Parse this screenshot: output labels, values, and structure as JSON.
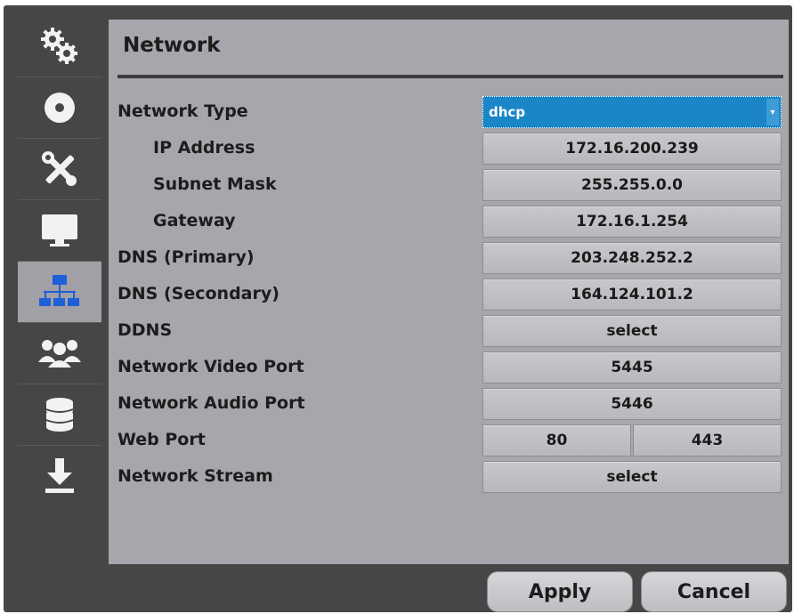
{
  "sidebar": {
    "items": [
      {
        "icon": "gears-icon",
        "active": false
      },
      {
        "icon": "disc-icon",
        "active": false
      },
      {
        "icon": "tools-icon",
        "active": false
      },
      {
        "icon": "monitor-icon",
        "active": false
      },
      {
        "icon": "network-icon",
        "active": true
      },
      {
        "icon": "users-icon",
        "active": false
      },
      {
        "icon": "database-icon",
        "active": false
      },
      {
        "icon": "download-icon",
        "active": false
      }
    ]
  },
  "page": {
    "title": "Network"
  },
  "settings": {
    "network_type": {
      "label": "Network Type",
      "value": "dhcp"
    },
    "ip_address": {
      "label": "IP Address",
      "value": "172.16.200.239"
    },
    "subnet_mask": {
      "label": "Subnet Mask",
      "value": "255.255.0.0"
    },
    "gateway": {
      "label": "Gateway",
      "value": "172.16.1.254"
    },
    "dns_primary": {
      "label": "DNS (Primary)",
      "value": "203.248.252.2"
    },
    "dns_secondary": {
      "label": "DNS (Secondary)",
      "value": "164.124.101.2"
    },
    "ddns": {
      "label": "DDNS",
      "value": "select"
    },
    "video_port": {
      "label": "Network Video Port",
      "value": "5445"
    },
    "audio_port": {
      "label": "Network Audio Port",
      "value": "5446"
    },
    "web_port": {
      "label": "Web Port",
      "http": "80",
      "https": "443"
    },
    "stream": {
      "label": "Network Stream",
      "value": "select"
    }
  },
  "actions": {
    "apply": "Apply",
    "cancel": "Cancel"
  },
  "colors": {
    "selected_field": "#1a86c8",
    "panel": "#a7a6ac",
    "frame": "#464646"
  }
}
